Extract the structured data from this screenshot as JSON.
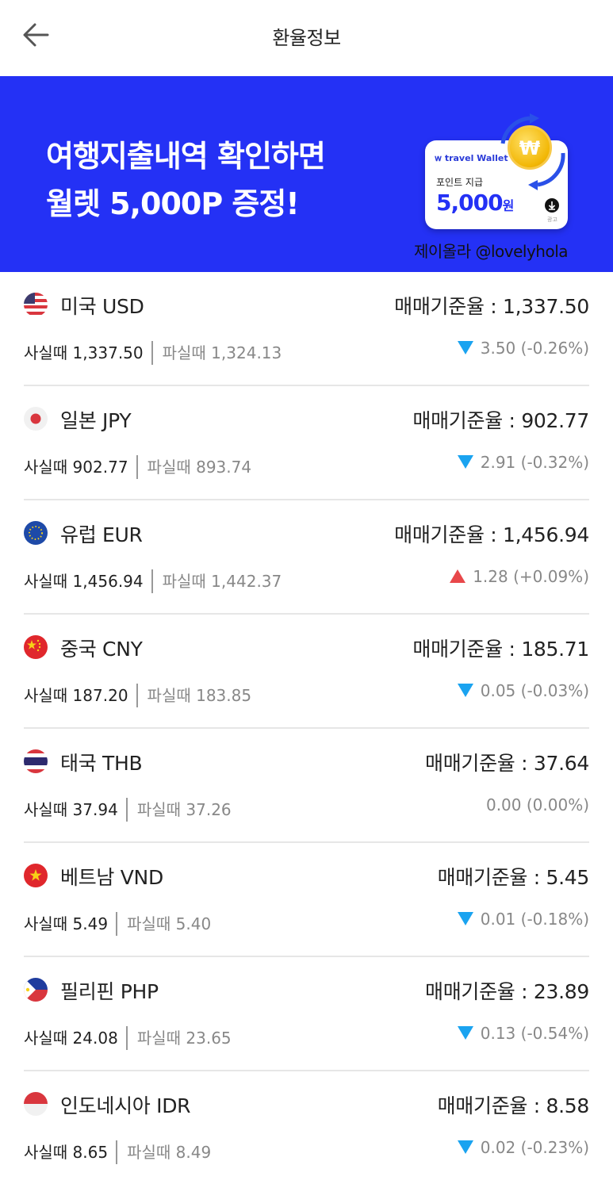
{
  "header": {
    "title": "환율정보"
  },
  "banner": {
    "line1": "여행지출내역 확인하면",
    "line2": "월렛 5,000P 증정!",
    "card_brand": "travel Wallet",
    "card_sub": "포인트 지급",
    "card_amount": "5,000",
    "card_unit": "원",
    "card_ad": "광고",
    "coin_glyph": "₩",
    "watermark": "제이올라 @lovelyhola"
  },
  "rates": [
    {
      "name": "미국 USD",
      "base": "매매기준율 : 1,337.50",
      "buy": "사실때 1,337.50",
      "sell": "파실때 1,324.13",
      "change": "3.50 (-0.26%)",
      "direction": "down",
      "flag": "us-flag-icon"
    },
    {
      "name": "일본 JPY",
      "base": "매매기준율 : 902.77",
      "buy": "사실때 902.77",
      "sell": "파실때 893.74",
      "change": "2.91 (-0.32%)",
      "direction": "down",
      "flag": "jp-flag-icon"
    },
    {
      "name": "유럽 EUR",
      "base": "매매기준율 : 1,456.94",
      "buy": "사실때 1,456.94",
      "sell": "파실때 1,442.37",
      "change": "1.28 (+0.09%)",
      "direction": "up",
      "flag": "eu-flag-icon"
    },
    {
      "name": "중국 CNY",
      "base": "매매기준율 : 185.71",
      "buy": "사실때 187.20",
      "sell": "파실때 183.85",
      "change": "0.05 (-0.03%)",
      "direction": "down",
      "flag": "cn-flag-icon"
    },
    {
      "name": "태국 THB",
      "base": "매매기준율 : 37.64",
      "buy": "사실때 37.94",
      "sell": "파실때 37.26",
      "change": "0.00 (0.00%)",
      "direction": "none",
      "flag": "th-flag-icon"
    },
    {
      "name": "베트남 VND",
      "base": "매매기준율 : 5.45",
      "buy": "사실때 5.49",
      "sell": "파실때 5.40",
      "change": "0.01 (-0.18%)",
      "direction": "down",
      "flag": "vn-flag-icon"
    },
    {
      "name": "필리핀 PHP",
      "base": "매매기준율 : 23.89",
      "buy": "사실때 24.08",
      "sell": "파실때 23.65",
      "change": "0.13 (-0.54%)",
      "direction": "down",
      "flag": "ph-flag-icon"
    },
    {
      "name": "인도네시아 IDR",
      "base": "매매기준율 : 8.58",
      "buy": "사실때 8.65",
      "sell": "파실때 8.49",
      "change": "0.02 (-0.23%)",
      "direction": "down",
      "flag": "id-flag-icon"
    }
  ],
  "colors": {
    "banner": "#2431f5",
    "down": "#1aa3f0",
    "up": "#e8474a"
  }
}
